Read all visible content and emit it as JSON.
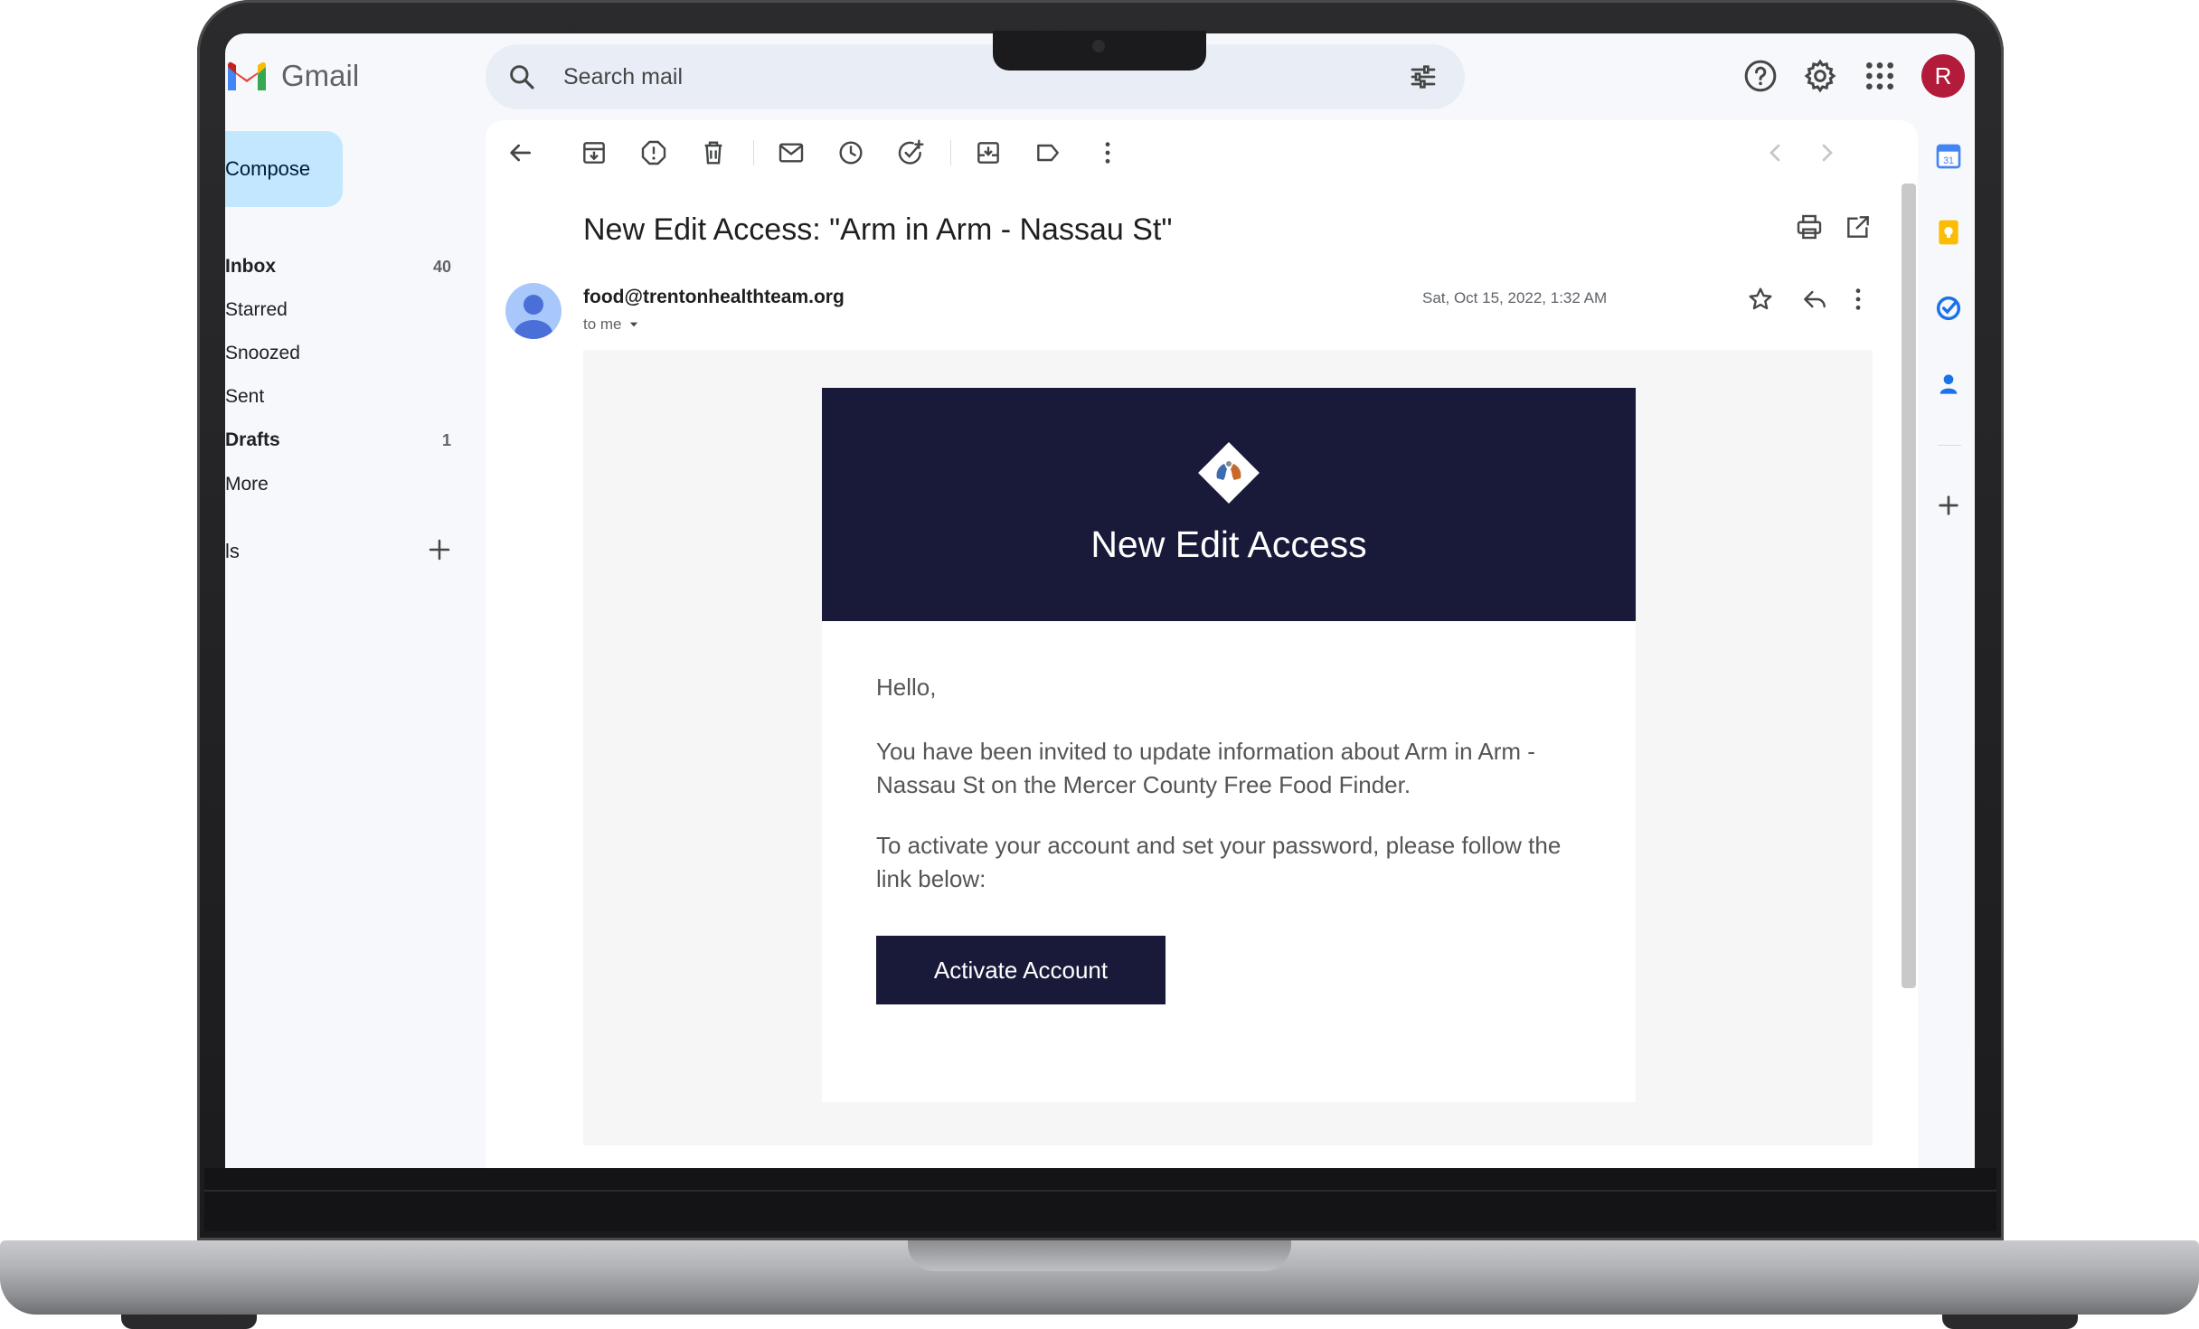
{
  "app": {
    "brand": "Gmail"
  },
  "search": {
    "placeholder": "Search mail"
  },
  "account": {
    "initial": "R",
    "color": "#b31b3a"
  },
  "nav": {
    "compose_label": "Compose",
    "items": [
      {
        "label": "Inbox",
        "count": "40",
        "bold": true
      },
      {
        "label": "Starred",
        "count": "",
        "bold": false
      },
      {
        "label": "Snoozed",
        "count": "",
        "bold": false
      },
      {
        "label": "Sent",
        "count": "",
        "bold": false
      },
      {
        "label": "Drafts",
        "count": "1",
        "bold": true
      },
      {
        "label": "More",
        "count": "",
        "bold": false
      }
    ],
    "labels_heading": "ls"
  },
  "message": {
    "subject": "New Edit Access: \"Arm in Arm - Nassau St\"",
    "sender": "food@trentonhealthteam.org",
    "recipient": "to me",
    "date": "Sat, Oct 15, 2022, 1:32 AM"
  },
  "email": {
    "header_title": "New Edit Access",
    "greeting": "Hello,",
    "paragraph1": "You have been invited to update information about Arm in Arm - Nassau St on the Mercer County Free Food Finder.",
    "paragraph2": "To activate your account and set your password, please follow the link below:",
    "button_label": "Activate Account",
    "brand_color": "#191a3a"
  },
  "icons": {
    "toolbar": [
      "back-icon",
      "archive-icon",
      "report-spam-icon",
      "delete-icon",
      "mark-unread-icon",
      "snooze-icon",
      "add-task-icon",
      "move-to-icon",
      "label-icon",
      "more-vert-icon",
      "newer-icon",
      "older-icon"
    ],
    "side_panel": [
      "calendar-icon",
      "keep-icon",
      "tasks-icon",
      "contacts-icon",
      "add-addon-icon"
    ]
  }
}
